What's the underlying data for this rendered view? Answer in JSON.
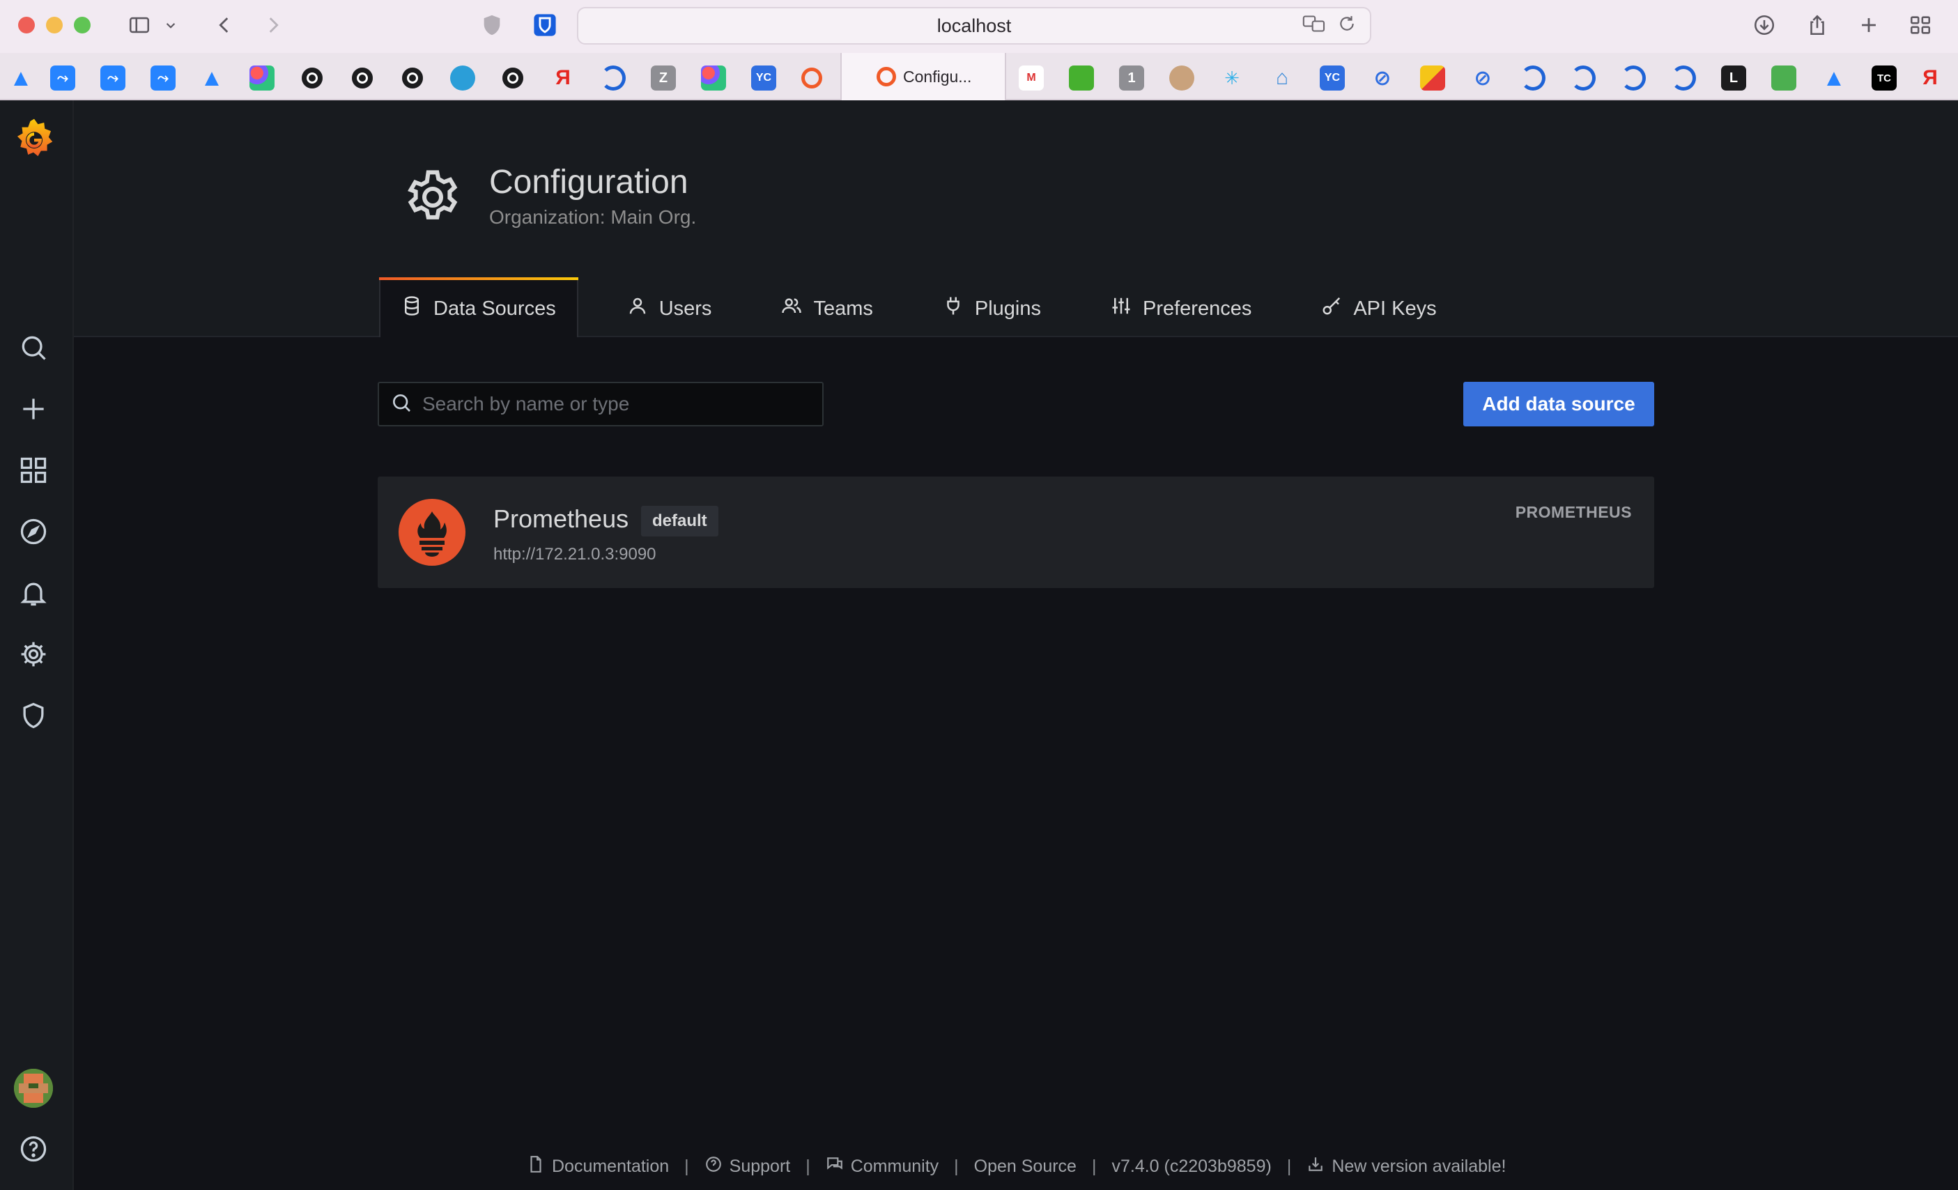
{
  "browser": {
    "url": "localhost",
    "active_tab_title": "Configu...",
    "bookmarks": [
      {
        "icon": "atlassian-icon"
      },
      {
        "icon": "jira-icon"
      },
      {
        "icon": "jira-icon"
      },
      {
        "icon": "jira-icon"
      },
      {
        "icon": "atlassian-icon"
      },
      {
        "icon": "colorful-dots-icon"
      },
      {
        "icon": "github-icon"
      },
      {
        "icon": "github-icon"
      },
      {
        "icon": "github-icon"
      },
      {
        "icon": "edge-icon"
      },
      {
        "icon": "github-icon"
      },
      {
        "icon": "yandex-icon",
        "text": "Я"
      },
      {
        "icon": "refresh-ring-icon"
      },
      {
        "icon": "z-icon",
        "text": "Z"
      },
      {
        "icon": "colorful-dots-icon"
      },
      {
        "icon": "yc-icon",
        "text": "YC"
      },
      {
        "icon": "grafana-icon"
      }
    ],
    "bookmarks_right": [
      {
        "icon": "gmail-100-icon"
      },
      {
        "icon": "green-square-icon"
      },
      {
        "icon": "one-icon",
        "text": "1"
      },
      {
        "icon": "avatar-icon"
      },
      {
        "icon": "sparkle-icon"
      },
      {
        "icon": "home-icon"
      },
      {
        "icon": "yc-icon",
        "text": "YC"
      },
      {
        "icon": "saturn-icon"
      },
      {
        "icon": "mail-icon"
      },
      {
        "icon": "saturn-icon"
      },
      {
        "icon": "refresh-ring-icon"
      },
      {
        "icon": "refresh-ring-icon"
      },
      {
        "icon": "refresh-ring-icon"
      },
      {
        "icon": "refresh-ring-icon"
      },
      {
        "icon": "l-icon",
        "text": "L"
      },
      {
        "icon": "leaf-icon"
      },
      {
        "icon": "atlassian-icon"
      },
      {
        "icon": "tc-icon",
        "text": "TC"
      },
      {
        "icon": "yandex-icon",
        "text": "Я"
      }
    ]
  },
  "page": {
    "title": "Configuration",
    "subtitle": "Organization: Main Org."
  },
  "tabs": [
    {
      "label": "Data Sources",
      "icon": "database-icon",
      "active": true
    },
    {
      "label": "Users",
      "icon": "user-icon"
    },
    {
      "label": "Teams",
      "icon": "users-icon"
    },
    {
      "label": "Plugins",
      "icon": "plug-icon"
    },
    {
      "label": "Preferences",
      "icon": "sliders-icon"
    },
    {
      "label": "API Keys",
      "icon": "key-icon"
    }
  ],
  "search": {
    "placeholder": "Search by name or type",
    "value": ""
  },
  "add_button_label": "Add data source",
  "datasources": [
    {
      "name": "Prometheus",
      "badge": "default",
      "url": "http://172.21.0.3:9090",
      "type": "PROMETHEUS"
    }
  ],
  "footer": {
    "documentation": "Documentation",
    "support": "Support",
    "community": "Community",
    "open_source": "Open Source",
    "version": "v7.4.0 (c2203b9859)",
    "new_version": "New version available!",
    "separator": "|"
  },
  "colors": {
    "accent": "#3871dc",
    "tab_gradient_start": "#f05a28",
    "tab_gradient_end": "#fbca0a",
    "prometheus": "#e6522c",
    "background": "#111217",
    "panel": "#181b1f"
  }
}
